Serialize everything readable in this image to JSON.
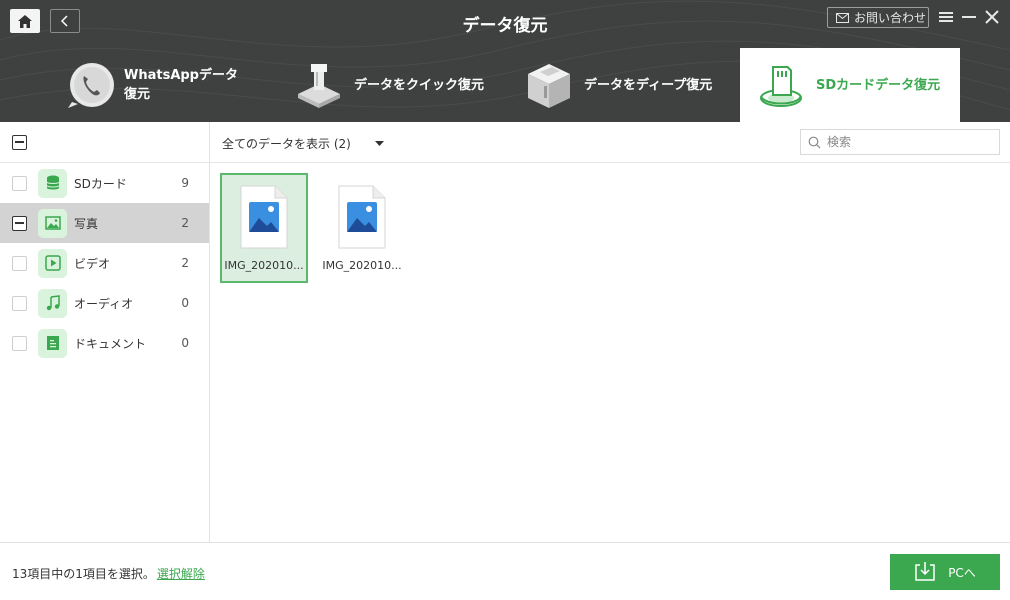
{
  "header": {
    "title": "データ復元",
    "contact_label": "お問い合わせ",
    "tabs": [
      {
        "label": "WhatsAppデータ復元",
        "icon": "whatsapp-phone-icon"
      },
      {
        "label": "データをクイック復元",
        "icon": "quick-recovery-icon"
      },
      {
        "label": "データをディープ復元",
        "icon": "deep-recovery-icon"
      },
      {
        "label": "SDカードデータ復元",
        "icon": "sd-card-icon",
        "active": true
      }
    ]
  },
  "sidebar": {
    "items": [
      {
        "label": "SDカード",
        "count": "9",
        "icon": "database-icon"
      },
      {
        "label": "写真",
        "count": "2",
        "icon": "photo-icon"
      },
      {
        "label": "ビデオ",
        "count": "2",
        "icon": "video-icon"
      },
      {
        "label": "オーディオ",
        "count": "0",
        "icon": "music-icon"
      },
      {
        "label": "ドキュメント",
        "count": "0",
        "icon": "document-icon"
      }
    ]
  },
  "toolbar": {
    "filter_label": "全てのデータを表示 (2)",
    "search_placeholder": "検索"
  },
  "files": [
    {
      "name": "IMG_202010...",
      "selected": true
    },
    {
      "name": "IMG_202010...",
      "selected": false
    }
  ],
  "footer": {
    "status_text": "13項目中の1項目を選択。",
    "deselect_link": "選択解除",
    "export_button": "PCへ"
  },
  "colors": {
    "accent": "#3ba84f",
    "header_bg": "#3f4140",
    "selected_bg": "#dbeedf"
  }
}
